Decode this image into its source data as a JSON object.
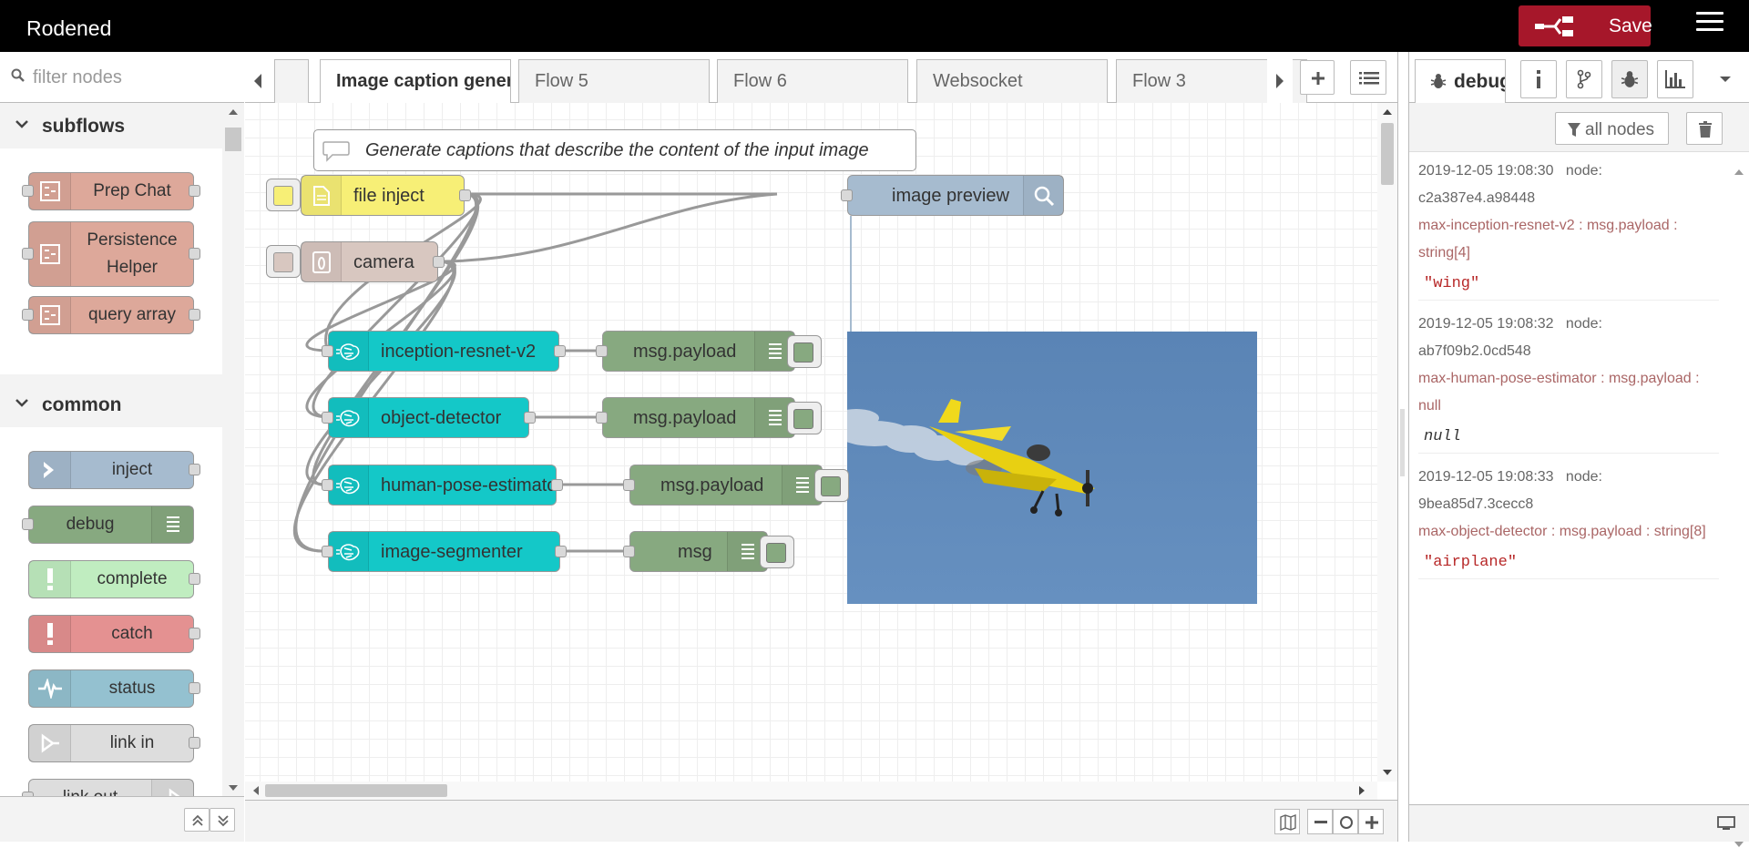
{
  "header": {
    "title": "Rodened",
    "deploy_label": "Save"
  },
  "palette": {
    "search_placeholder": "filter nodes",
    "categories": [
      {
        "title": "subflows",
        "nodes": [
          "Prep Chat",
          "Persistence Helper",
          "query array"
        ]
      },
      {
        "title": "common",
        "nodes": [
          "inject",
          "debug",
          "complete",
          "catch",
          "status",
          "link in",
          "link out"
        ]
      }
    ]
  },
  "tabs": [
    "Image caption generator",
    "Flow 5",
    "Flow 6",
    "Websocket",
    "Flow 3"
  ],
  "canvas": {
    "comment": "Generate captions that describe the content of the input image",
    "nodes": {
      "file_inject": "file inject",
      "camera": "camera",
      "image_preview": "image preview",
      "inception": "inception-resnet-v2",
      "object_detector": "object-detector",
      "human_pose": "human-pose-estimator",
      "image_segmenter": "image-segmenter",
      "debug1": "msg.payload",
      "debug2": "msg.payload",
      "debug3": "msg.payload",
      "debug4": "msg"
    }
  },
  "sidebar": {
    "active_tab": "debug",
    "filter_label": "all nodes",
    "messages": [
      {
        "time": "2019-12-05 19:08:30",
        "node_label": "node:",
        "node_id": "c2a387e4.a98448",
        "topic": "max-inception-resnet-v2 : msg.payload : string[4]",
        "value": "\"wing\"",
        "kind": "str"
      },
      {
        "time": "2019-12-05 19:08:32",
        "node_label": "node:",
        "node_id": "ab7f09b2.0cd548",
        "topic": "max-human-pose-estimator : msg.payload : null",
        "value": "null",
        "kind": "nul"
      },
      {
        "time": "2019-12-05 19:08:33",
        "node_label": "node:",
        "node_id": "9bea85d7.3cecc8",
        "topic": "max-object-detector : msg.payload : string[8]",
        "value": "\"airplane\"",
        "kind": "str"
      }
    ]
  },
  "colors": {
    "header_bg": "#000000",
    "deploy_red": "#a6172a",
    "subflow": "#dda89a",
    "inject": "#a6bbcf",
    "debug": "#87a980",
    "complete": "#c0edc0",
    "catch": "#e49191",
    "status": "#94c1d0",
    "link": "#dddddd",
    "max_node": "#14c8c8",
    "file_inject": "#f7ef76",
    "camera": "#d8c7c0"
  }
}
